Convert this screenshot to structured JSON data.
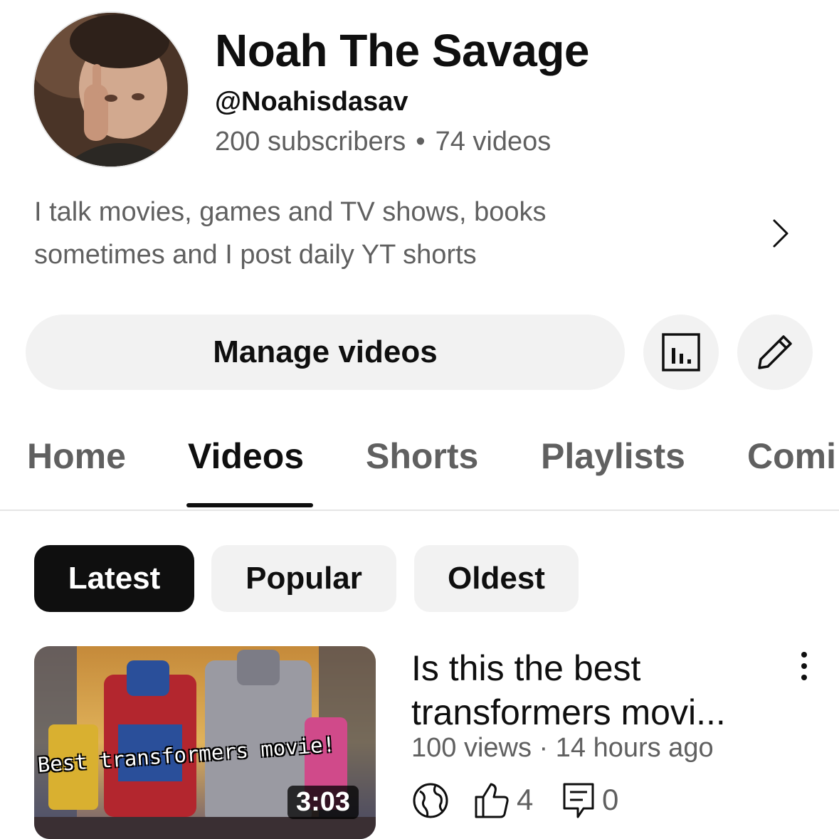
{
  "channel": {
    "name": "Noah The Savage",
    "handle": "@Noahisdasav",
    "subscribers": "200 subscribers",
    "separator": "•",
    "videos": "74 videos",
    "description_line1": "I talk movies, games and TV shows, books",
    "description_line2": "sometimes and I post daily YT shorts"
  },
  "actions": {
    "manage_label": "Manage videos"
  },
  "tabs": [
    {
      "label": "Home"
    },
    {
      "label": "Videos"
    },
    {
      "label": "Shorts"
    },
    {
      "label": "Playlists"
    },
    {
      "label": "Comi"
    }
  ],
  "active_tab": "Videos",
  "filters": [
    {
      "label": "Latest"
    },
    {
      "label": "Popular"
    },
    {
      "label": "Oldest"
    }
  ],
  "active_filter": "Latest",
  "video": {
    "thumbnail_caption": "Best transformers movie!",
    "duration": "3:03",
    "title": "Is this the best transformers movi...",
    "meta": "100 views · 14 hours ago",
    "likes": "4",
    "comments": "0"
  },
  "icons": {
    "description_more": "chevron-right-icon",
    "analytics": "bar-chart-icon",
    "edit": "pencil-icon",
    "more": "vertical-dots-icon",
    "visibility": "globe-icon",
    "likes": "thumbs-up-icon",
    "comments": "comment-icon"
  },
  "colors": {
    "primary_text": "#0f0f0f",
    "secondary_text": "#606060",
    "chip_bg": "#f2f2f2",
    "chip_active_bg": "#0f0f0f"
  }
}
